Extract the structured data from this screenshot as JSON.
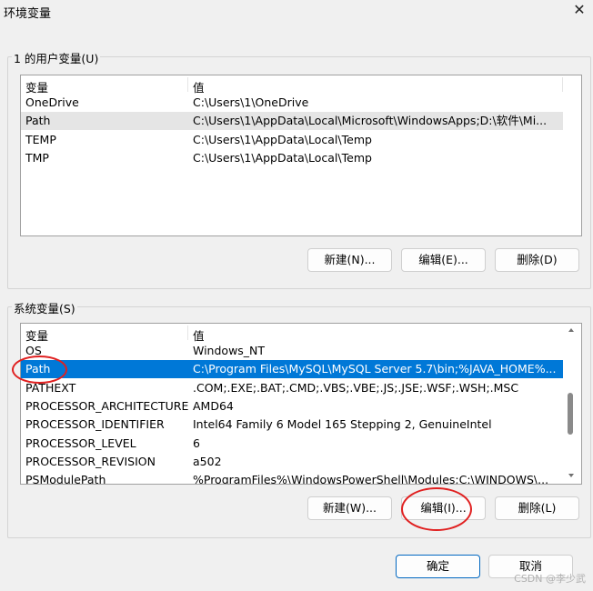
{
  "window": {
    "title": "环境变量",
    "close_glyph": "✕"
  },
  "user_vars": {
    "label": "1 的用户变量(U)",
    "headers": [
      "变量",
      "值"
    ],
    "rows": [
      {
        "name": "OneDrive",
        "value": "C:\\Users\\1\\OneDrive"
      },
      {
        "name": "Path",
        "value": "C:\\Users\\1\\AppData\\Local\\Microsoft\\WindowsApps;D:\\软件\\Mi..."
      },
      {
        "name": "TEMP",
        "value": "C:\\Users\\1\\AppData\\Local\\Temp"
      },
      {
        "name": "TMP",
        "value": "C:\\Users\\1\\AppData\\Local\\Temp"
      }
    ],
    "selected_row": 1,
    "buttons": {
      "new": "新建(N)...",
      "edit": "编辑(E)...",
      "delete": "删除(D)"
    }
  },
  "system_vars": {
    "label": "系统变量(S)",
    "headers": [
      "变量",
      "值"
    ],
    "rows": [
      {
        "name": "OS",
        "value": "Windows_NT"
      },
      {
        "name": "Path",
        "value": "C:\\Program Files\\MySQL\\MySQL Server 5.7\\bin;%JAVA_HOME%..."
      },
      {
        "name": "PATHEXT",
        "value": ".COM;.EXE;.BAT;.CMD;.VBS;.VBE;.JS;.JSE;.WSF;.WSH;.MSC"
      },
      {
        "name": "PROCESSOR_ARCHITECTURE",
        "value": "AMD64"
      },
      {
        "name": "PROCESSOR_IDENTIFIER",
        "value": "Intel64 Family 6 Model 165 Stepping 2, GenuineIntel"
      },
      {
        "name": "PROCESSOR_LEVEL",
        "value": "6"
      },
      {
        "name": "PROCESSOR_REVISION",
        "value": "a502"
      },
      {
        "name": "PSModulePath",
        "value": "%ProgramFiles%\\WindowsPowerShell\\Modules;C:\\WINDOWS\\..."
      }
    ],
    "selected_row": 1,
    "buttons": {
      "new": "新建(W)...",
      "edit": "编辑(I)...",
      "delete": "删除(L)"
    }
  },
  "footer": {
    "ok": "确定",
    "cancel": "取消"
  },
  "watermark": "CSDN @李少武",
  "colors": {
    "selection_blue": "#0078d7",
    "annotation_red": "#e02020",
    "primary_border": "#0067c0"
  }
}
